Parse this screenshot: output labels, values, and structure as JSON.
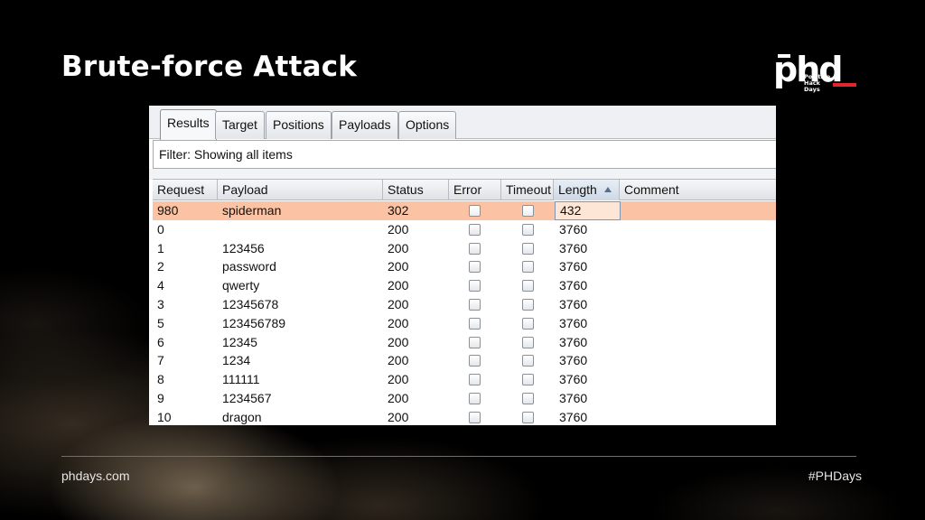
{
  "slide": {
    "title": "Brute-force Attack",
    "footer_left": "phdays.com",
    "footer_right": "#PHDays"
  },
  "logo": {
    "mark": "phd",
    "lines": [
      "Positive",
      "Hack",
      "Days"
    ],
    "accent_color": "#e3262d"
  },
  "tabs": [
    {
      "label": "Results",
      "active": true
    },
    {
      "label": "Target",
      "active": false
    },
    {
      "label": "Positions",
      "active": false
    },
    {
      "label": "Payloads",
      "active": false
    },
    {
      "label": "Options",
      "active": false
    }
  ],
  "filter": {
    "text": "Filter: Showing all items"
  },
  "table": {
    "columns": [
      "Request",
      "Payload",
      "Status",
      "Error",
      "Timeout",
      "Length",
      "Comment"
    ],
    "sorted_column": "Length",
    "sort_direction": "ascending",
    "selected_row_color": "#fbc3a3",
    "rows": [
      {
        "request": "980",
        "payload": "spiderman",
        "status": "302",
        "error": false,
        "timeout": false,
        "length": "432",
        "comment": "",
        "selected": true
      },
      {
        "request": "0",
        "payload": "",
        "status": "200",
        "error": false,
        "timeout": false,
        "length": "3760",
        "comment": "",
        "selected": false
      },
      {
        "request": "1",
        "payload": "123456",
        "status": "200",
        "error": false,
        "timeout": false,
        "length": "3760",
        "comment": "",
        "selected": false
      },
      {
        "request": "2",
        "payload": "password",
        "status": "200",
        "error": false,
        "timeout": false,
        "length": "3760",
        "comment": "",
        "selected": false
      },
      {
        "request": "4",
        "payload": "qwerty",
        "status": "200",
        "error": false,
        "timeout": false,
        "length": "3760",
        "comment": "",
        "selected": false
      },
      {
        "request": "3",
        "payload": "12345678",
        "status": "200",
        "error": false,
        "timeout": false,
        "length": "3760",
        "comment": "",
        "selected": false
      },
      {
        "request": "5",
        "payload": "123456789",
        "status": "200",
        "error": false,
        "timeout": false,
        "length": "3760",
        "comment": "",
        "selected": false
      },
      {
        "request": "6",
        "payload": "12345",
        "status": "200",
        "error": false,
        "timeout": false,
        "length": "3760",
        "comment": "",
        "selected": false
      },
      {
        "request": "7",
        "payload": "1234",
        "status": "200",
        "error": false,
        "timeout": false,
        "length": "3760",
        "comment": "",
        "selected": false
      },
      {
        "request": "8",
        "payload": "111111",
        "status": "200",
        "error": false,
        "timeout": false,
        "length": "3760",
        "comment": "",
        "selected": false
      },
      {
        "request": "9",
        "payload": "1234567",
        "status": "200",
        "error": false,
        "timeout": false,
        "length": "3760",
        "comment": "",
        "selected": false
      },
      {
        "request": "10",
        "payload": "dragon",
        "status": "200",
        "error": false,
        "timeout": false,
        "length": "3760",
        "comment": "",
        "selected": false
      }
    ]
  }
}
